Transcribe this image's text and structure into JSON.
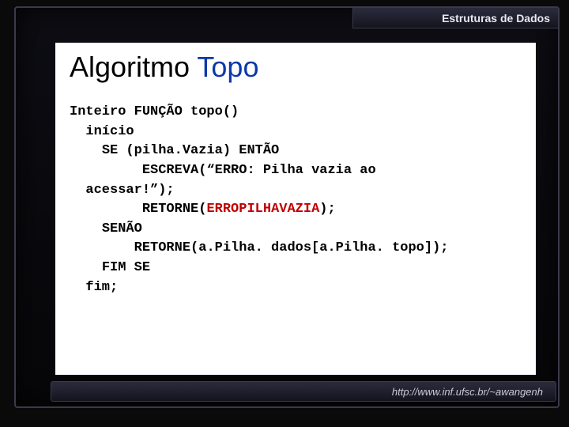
{
  "header": {
    "course": "Estruturas de Dados"
  },
  "title": {
    "part1": "Algoritmo ",
    "part2": "Topo"
  },
  "code": {
    "l1": "Inteiro FUNÇÃO topo()",
    "l2": "  início",
    "l3": "    SE (pilha.Vazia) ENTÃO",
    "l4": "         ESCREVA(“ERRO: Pilha vazia ao",
    "l5": "  acessar!”);",
    "l6_pre": "         RETORNE(",
    "l6_err": "ERROPILHAVAZIA",
    "l6_post": ");",
    "l7": "    SENÃO",
    "l8": "        RETORNE(a.Pilha. dados[a.Pilha. topo]);",
    "l9": "    FIM SE",
    "l10": "  fim;"
  },
  "footer": {
    "url": "http://www.inf.ufsc.br/~awangenh"
  }
}
